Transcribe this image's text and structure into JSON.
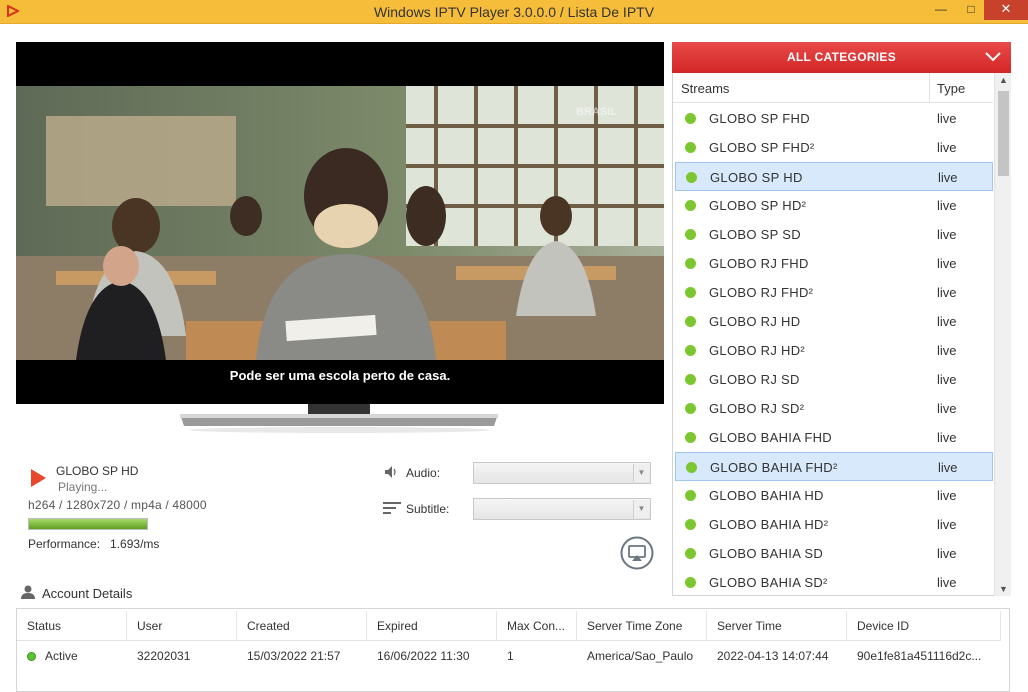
{
  "window": {
    "title": "Windows IPTV Player 3.0.0.0 / Lista De IPTV",
    "minimize_icon": "—",
    "maximize_icon": "□",
    "close_icon": "✕"
  },
  "video": {
    "subtitle_text": "Pode ser uma escola perto de casa.",
    "watermark": "BRASIL"
  },
  "now_playing": {
    "channel": "GLOBO SP HD",
    "status": "Playing...",
    "codec_info": "h264 / 1280x720 / mp4a / 48000",
    "buffer_level": 1.0,
    "performance_label": "Performance:",
    "performance_value": "1.693/ms"
  },
  "controls": {
    "audio_label": "Audio:",
    "audio_value": "",
    "subtitle_label": "Subtitle:",
    "subtitle_value": ""
  },
  "account": {
    "section_title": "Account Details",
    "columns": [
      "Status",
      "User",
      "Created",
      "Expired",
      "Max Con...",
      "Server Time Zone",
      "Server Time",
      "Device ID"
    ],
    "row": {
      "status": "Active",
      "user": "32202031",
      "created": "15/03/2022 21:57",
      "expired": "16/06/2022 11:30",
      "max_connections": "1",
      "server_time_zone": "America/Sao_Paulo",
      "server_time": "2022-04-13 14:07:44",
      "device_id": "90e1fe81a451116d2c..."
    }
  },
  "panel": {
    "category": "ALL CATEGORIES",
    "col_streams": "Streams",
    "col_type": "Type",
    "streams": [
      {
        "name": "GLOBO SP FHD",
        "type": "live"
      },
      {
        "name": "GLOBO SP FHD²",
        "type": "live"
      },
      {
        "name": "GLOBO SP HD",
        "type": "live"
      },
      {
        "name": "GLOBO SP HD²",
        "type": "live"
      },
      {
        "name": "GLOBO SP SD",
        "type": "live"
      },
      {
        "name": "GLOBO RJ FHD",
        "type": "live"
      },
      {
        "name": "GLOBO RJ FHD²",
        "type": "live"
      },
      {
        "name": "GLOBO RJ HD",
        "type": "live"
      },
      {
        "name": "GLOBO RJ HD²",
        "type": "live"
      },
      {
        "name": "GLOBO RJ SD",
        "type": "live"
      },
      {
        "name": "GLOBO RJ SD²",
        "type": "live"
      },
      {
        "name": "GLOBO BAHIA FHD",
        "type": "live"
      },
      {
        "name": "GLOBO BAHIA FHD²",
        "type": "live"
      },
      {
        "name": "GLOBO BAHIA HD",
        "type": "live"
      },
      {
        "name": "GLOBO BAHIA HD²",
        "type": "live"
      },
      {
        "name": "GLOBO BAHIA SD",
        "type": "live"
      },
      {
        "name": "GLOBO BAHIA SD²",
        "type": "live"
      }
    ],
    "selected_index": 2,
    "hover_index": 12
  },
  "colors": {
    "titlebar": "#f6bd3b",
    "accent_red": "#d32626",
    "live_dot": "#7cc72f",
    "selection": "#d7e9fb"
  }
}
